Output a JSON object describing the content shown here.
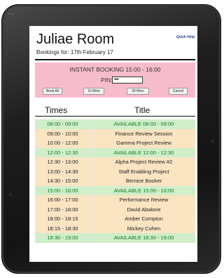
{
  "room": {
    "title": "Juliae Room",
    "quick_help": "Quick Help",
    "subtitle": "Bookings for: 17th February 17"
  },
  "booking": {
    "title": "INSTANT BOOKING 15:00 - 16:00",
    "pin_label": "PIN:",
    "pin_value": "••••",
    "buttons": [
      "Book All",
      "15 Mins",
      "30 Mins",
      "Cancel"
    ]
  },
  "table": {
    "headers": {
      "times": "Times",
      "title": "Title"
    },
    "rows": [
      {
        "time": "08:00 - 09:00",
        "title": "AVAILABLE 08:00 - 09:00",
        "status": "available"
      },
      {
        "time": "09:00 - 10:00",
        "title": "Finance Review Session",
        "status": "booked"
      },
      {
        "time": "10:00 - 12:00",
        "title": "Gamma Project Review",
        "status": "booked"
      },
      {
        "time": "12:00 - 12:30",
        "title": "AVAILABLE 12:00 - 12:30",
        "status": "available"
      },
      {
        "time": "12:30 - 13:00",
        "title": "Alpha Project Review #2",
        "status": "booked"
      },
      {
        "time": "13:00 - 14:30",
        "title": "Staff Enabling Project",
        "status": "booked"
      },
      {
        "time": "14:30 - 15:00",
        "title": "Bernice Booker",
        "status": "booked"
      },
      {
        "time": "15:00 - 16:00",
        "title": "AVAILABLE 15:00 - 16:00",
        "status": "available"
      },
      {
        "time": "16:00 - 17:00",
        "title": "Performance Review",
        "status": "booked"
      },
      {
        "time": "17:00 - 18:00",
        "title": "David Abalone",
        "status": "booked"
      },
      {
        "time": "18:00 - 18:15",
        "title": "Amber Compton",
        "status": "booked"
      },
      {
        "time": "18:15 - 18:30",
        "title": "Mickey Cohen",
        "status": "booked"
      },
      {
        "time": "18:30 - 19:00",
        "title": "AVAILABLE 18:30 - 19:00",
        "status": "available"
      }
    ]
  },
  "colors": {
    "available_bg": "#cfeec9",
    "available_text": "#157a24",
    "booked_bg": "#fbe4c2",
    "instant_booking_bg": "#f7bccb"
  }
}
